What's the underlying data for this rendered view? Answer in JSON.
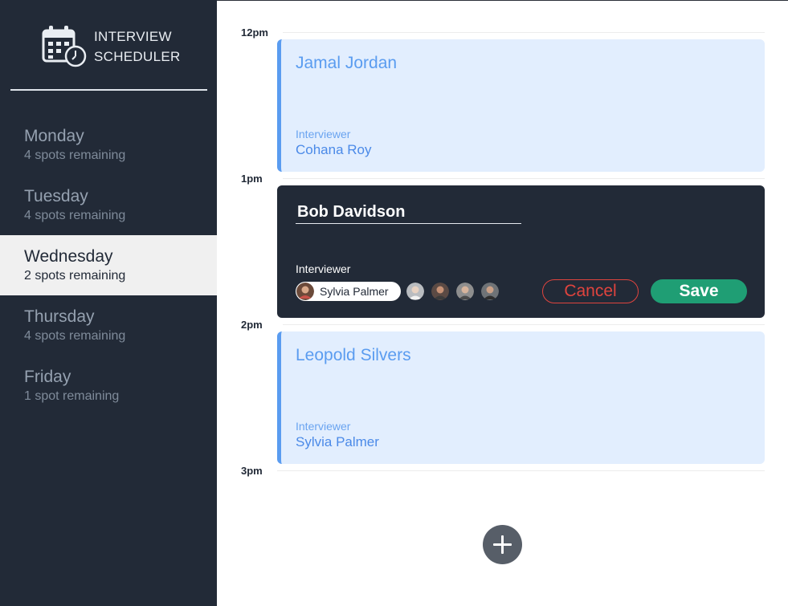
{
  "app": {
    "title_line1": "INTERVIEW",
    "title_line2": "SCHEDULER",
    "logo_icon": "calendar-clock-icon"
  },
  "days": [
    {
      "name": "Monday",
      "spots": "4 spots remaining",
      "selected": false
    },
    {
      "name": "Tuesday",
      "spots": "4 spots remaining",
      "selected": false
    },
    {
      "name": "Wednesday",
      "spots": "2 spots remaining",
      "selected": true
    },
    {
      "name": "Thursday",
      "spots": "4 spots remaining",
      "selected": false
    },
    {
      "name": "Friday",
      "spots": "1 spot remaining",
      "selected": false
    }
  ],
  "times": [
    "12pm",
    "1pm",
    "2pm",
    "3pm"
  ],
  "appointments": [
    {
      "student": "Jamal Jordan",
      "interviewer_label": "Interviewer",
      "interviewer": "Cohana Roy"
    },
    {
      "student": "Leopold Silvers",
      "interviewer_label": "Interviewer",
      "interviewer": "Sylvia Palmer"
    }
  ],
  "edit_form": {
    "student_value": "Bob Davidson",
    "interviewer_label": "Interviewer",
    "selected_interviewer": "Sylvia Palmer",
    "other_interviewer_avatars": 4,
    "cancel_label": "Cancel",
    "save_label": "Save"
  },
  "add_button_icon": "plus-icon",
  "colors": {
    "sidebar": "#222a37",
    "appointment_bg": "#e2eefe",
    "accent": "#5a9cf0",
    "cancel": "#e0443e",
    "save": "#1f9e74"
  }
}
